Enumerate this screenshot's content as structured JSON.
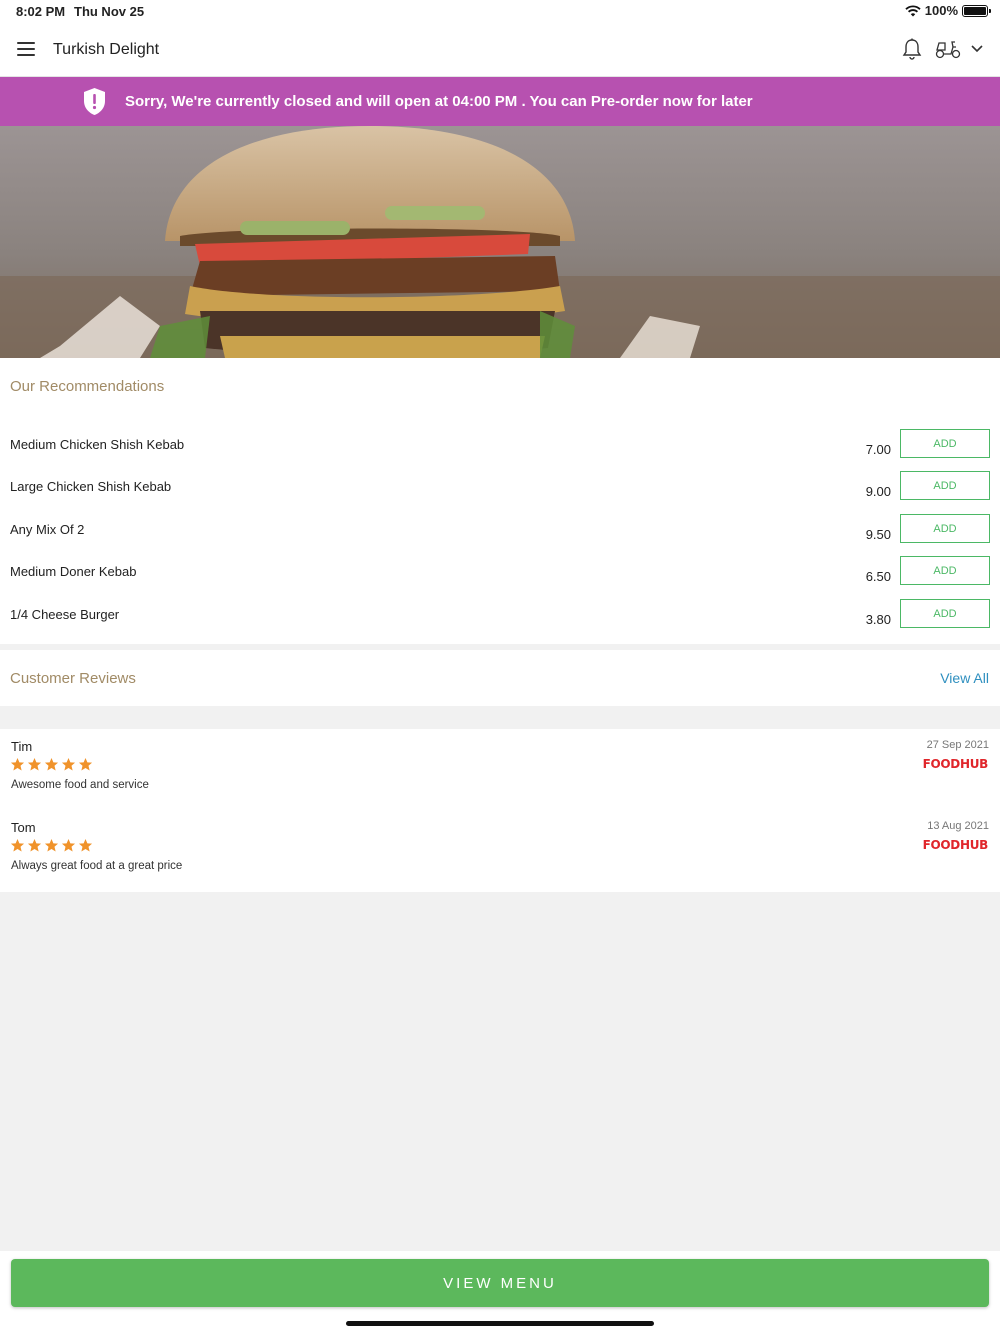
{
  "status_bar": {
    "time": "8:02 PM",
    "date": "Thu Nov 25",
    "battery": "100%"
  },
  "header": {
    "title": "Turkish Delight",
    "menu_icon": "hamburger-icon",
    "bell_icon": "bell-icon",
    "delivery_icon": "scooter-icon"
  },
  "banner": {
    "text": "Sorry, We're currently closed and will open at 04:00 PM . You can Pre-order now for later",
    "color": "#b751b0",
    "icon": "shield-alert-icon"
  },
  "recommendations": {
    "title": "Our Recommendations",
    "items": [
      {
        "name": "Medium Chicken Shish Kebab",
        "price": "7.00",
        "button": "ADD"
      },
      {
        "name": "Large Chicken Shish Kebab",
        "price": "9.00",
        "button": "ADD"
      },
      {
        "name": "Any Mix Of 2",
        "price": "9.50",
        "button": "ADD"
      },
      {
        "name": "Medium Doner Kebab",
        "price": "6.50",
        "button": "ADD"
      },
      {
        "name": "1/4 Cheese Burger",
        "price": "3.80",
        "button": "ADD"
      }
    ]
  },
  "reviews": {
    "title": "Customer Reviews",
    "view_all": "View All",
    "items": [
      {
        "name": "Tim",
        "rating": 5,
        "text": "Awesome food and service",
        "date": "27 Sep 2021",
        "source": "FOODHUB"
      },
      {
        "name": "Tom",
        "rating": 5,
        "text": "Always great food at a great price",
        "date": "13 Aug 2021",
        "source": "FOODHUB"
      }
    ]
  },
  "footer": {
    "view_menu": "VIEW MENU",
    "accent": "#5cb85c"
  }
}
